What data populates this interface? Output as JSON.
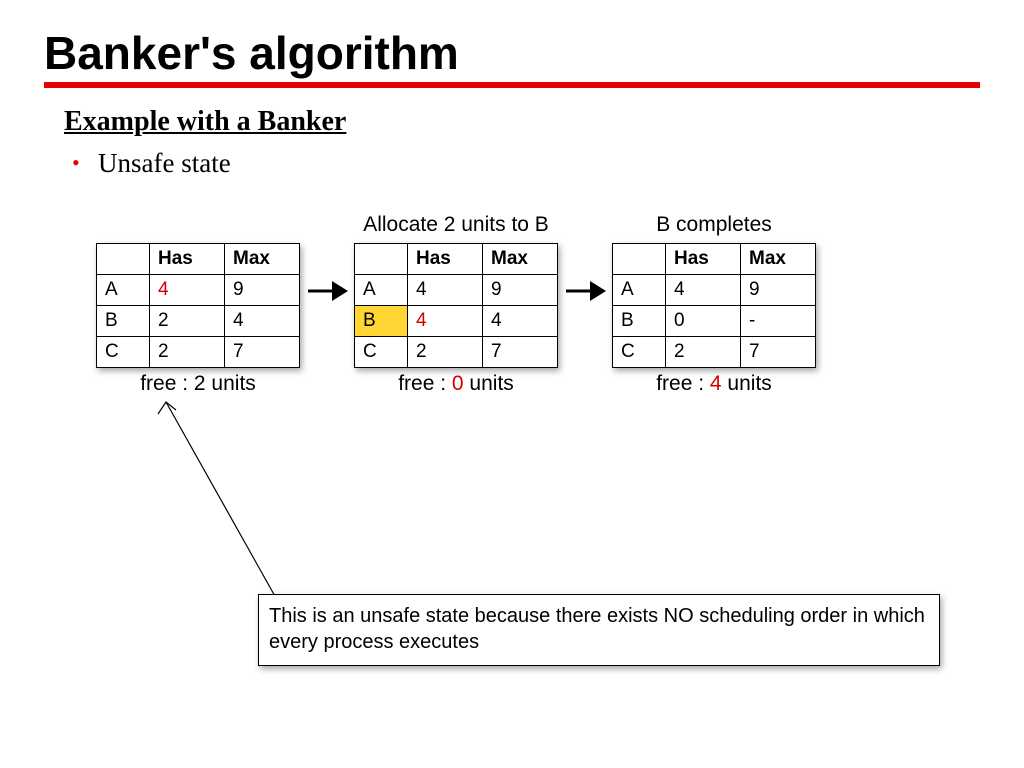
{
  "title": "Banker's algorithm",
  "subtitle": "Example with a Banker",
  "bullet": "Unsafe state",
  "headers": {
    "has": "Has",
    "max": "Max"
  },
  "tables": [
    {
      "caption": "",
      "rows": [
        {
          "name": "A",
          "has": "4",
          "max": "9",
          "hasRed": true
        },
        {
          "name": "B",
          "has": "2",
          "max": "4"
        },
        {
          "name": "C",
          "has": "2",
          "max": "7"
        }
      ],
      "free_prefix": "free : ",
      "free_value": "2",
      "free_suffix": " units",
      "freeRed": false
    },
    {
      "caption": "Allocate 2 units to B",
      "rows": [
        {
          "name": "A",
          "has": "4",
          "max": "9"
        },
        {
          "name": "B",
          "has": "4",
          "max": "4",
          "hl": true,
          "hasRed": true
        },
        {
          "name": "C",
          "has": "2",
          "max": "7"
        }
      ],
      "free_prefix": "free : ",
      "free_value": "0",
      "free_suffix": " units",
      "freeRed": true
    },
    {
      "caption": "B completes",
      "rows": [
        {
          "name": "A",
          "has": "4",
          "max": "9"
        },
        {
          "name": "B",
          "has": "0",
          "max": "-"
        },
        {
          "name": "C",
          "has": "2",
          "max": "7"
        }
      ],
      "free_prefix": "free : ",
      "free_value": "4",
      "free_suffix": " units",
      "freeRed": true
    }
  ],
  "callout": "This is an unsafe state because there exists NO scheduling order in which every process executes"
}
